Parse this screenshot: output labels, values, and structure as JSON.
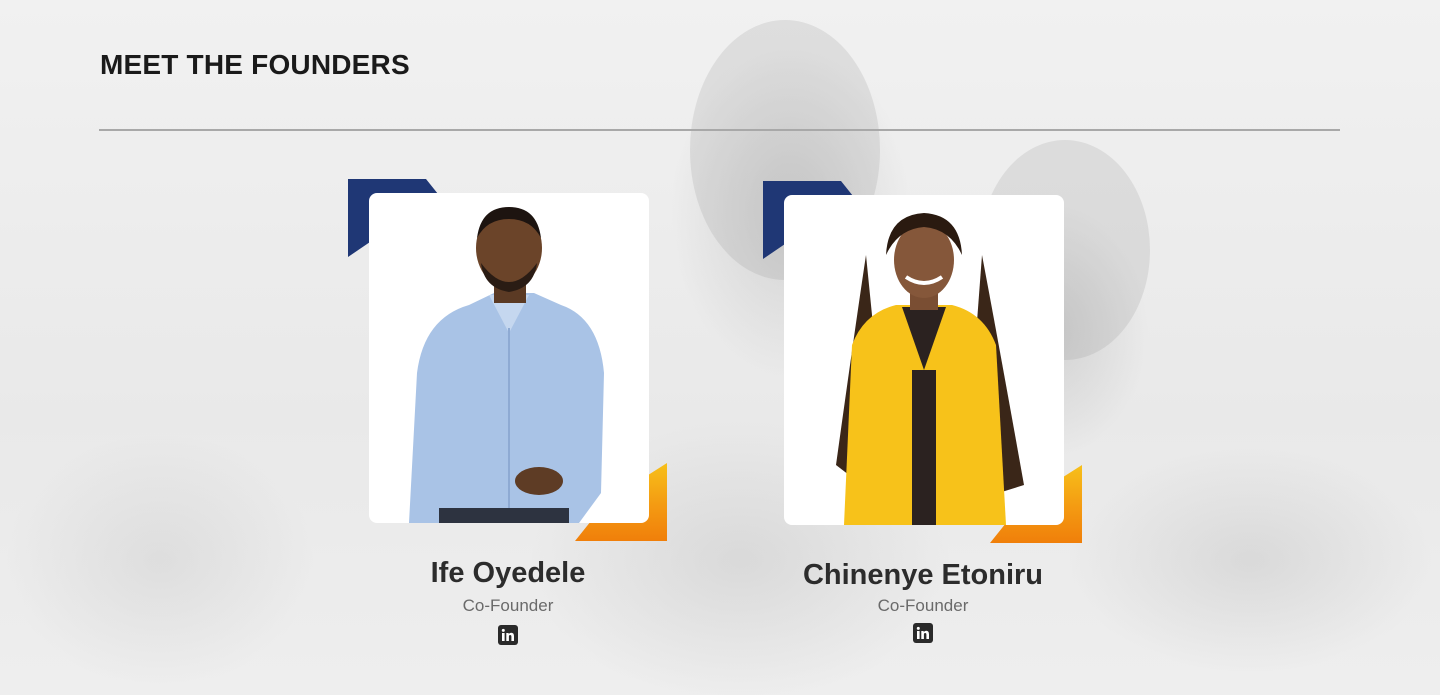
{
  "section": {
    "heading": "MEET THE FOUNDERS"
  },
  "founders": [
    {
      "name": "Ife Oyedele",
      "role": "Co-Founder",
      "social_icon": "linkedin-icon"
    },
    {
      "name": "Chinenye Etoniru",
      "role": "Co-Founder",
      "social_icon": "linkedin-icon"
    }
  ],
  "colors": {
    "accent_blue": "#1f3775",
    "accent_orange": "#f49a12",
    "heading_text": "#1a1a1a",
    "role_text": "#6a6a6a"
  }
}
